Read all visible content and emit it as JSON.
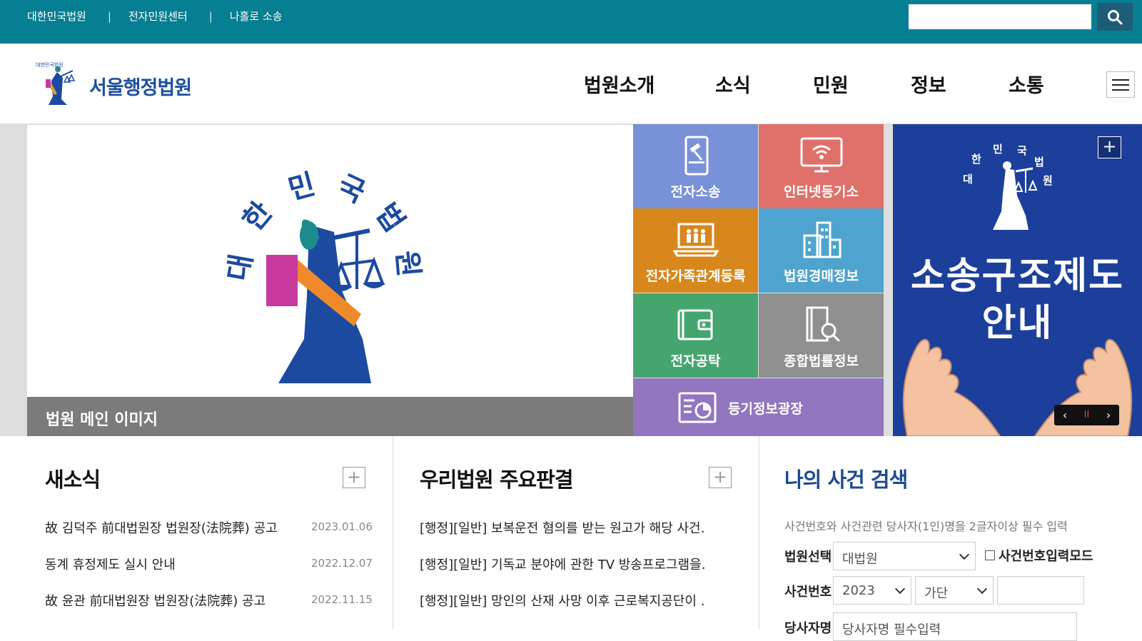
{
  "topbar": {
    "links": [
      "대한민국법원",
      "전자민원센터",
      "나홀로 소송"
    ],
    "separator": "|",
    "search_placeholder": "",
    "search_icon": "search-icon"
  },
  "header": {
    "logo_text": "서울행정법원",
    "nav": [
      "법원소개",
      "소식",
      "민원",
      "정보",
      "소통"
    ],
    "menu_icon": "hamburger-icon"
  },
  "hero": {
    "caption": "법원 메인 이미지",
    "emblem_text": "대한민국법원"
  },
  "quick_links": [
    {
      "label": "전자소송",
      "icon": "tablet-gavel-icon",
      "color": "#7891d8"
    },
    {
      "label": "인터넷등기소",
      "icon": "monitor-wifi-icon",
      "color": "#e0706a"
    },
    {
      "label": "전자가족관계등록",
      "icon": "family-laptop-icon",
      "color": "#d8871c"
    },
    {
      "label": "법원경매정보",
      "icon": "buildings-icon",
      "color": "#4fa3cf"
    },
    {
      "label": "전자공탁",
      "icon": "wallet-icon",
      "color": "#45a56f"
    },
    {
      "label": "종합법률정보",
      "icon": "book-search-icon",
      "color": "#8f8f8f"
    },
    {
      "label": "등기정보광장",
      "icon": "chart-board-icon",
      "color": "#9276bf"
    }
  ],
  "banner": {
    "title_line1": "소송구조제도",
    "title_line2": "안내",
    "plus": "+",
    "prev": "‹",
    "pause": "II",
    "next": "›"
  },
  "news": {
    "title": "새소식",
    "plus": "+",
    "items": [
      {
        "title": "故 김덕주 前대법원장 법원장(法院葬) 공고",
        "date": "2023.01.06"
      },
      {
        "title": "동계 휴정제도 실시 안내",
        "date": "2022.12.07"
      },
      {
        "title": "故 윤관 前대법원장 법원장(法院葬) 공고",
        "date": "2022.11.15"
      }
    ]
  },
  "rulings": {
    "title": "우리법원 주요판결",
    "plus": "+",
    "items": [
      "[행정][일반] 보복운전 혐의를 받는 원고가 해당 사건…",
      "[행정][일반] 기독교 분야에 관한 TV 방송프로그램을…",
      "[행정][일반] 망인의 산재 사망 이후 근로복지공단이 …"
    ]
  },
  "case_search": {
    "title": "나의 사건 검색",
    "note": "사건번호와 사건관련 당사자(1인)명을 2글자이상 필수 입력",
    "court_label": "법원선택",
    "court_value": "대법원",
    "mode_label": "사건번호입력모드",
    "case_no_label": "사건번호",
    "year_value": "2023",
    "type_value": "가단",
    "party_label": "당사자명",
    "party_placeholder": "당사자명 필수입력"
  }
}
